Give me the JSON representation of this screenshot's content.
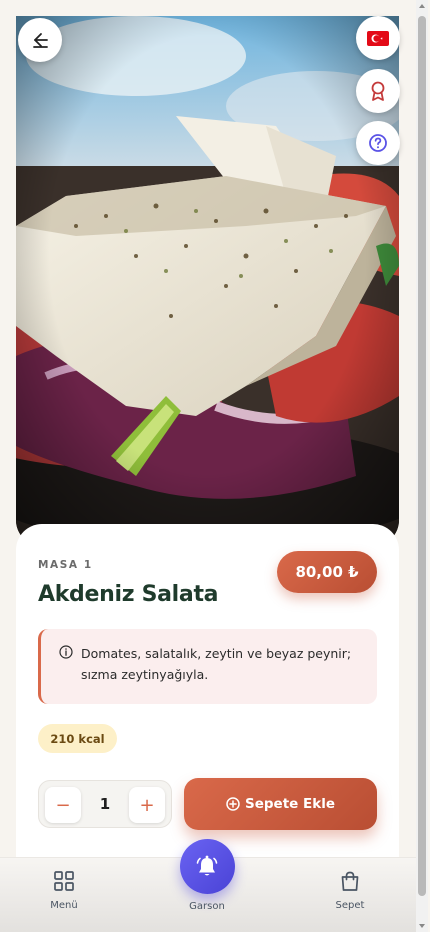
{
  "header": {
    "back_icon": "arrow-left-icon",
    "flag_icon": "turkish-flag-icon",
    "badge_icon": "award-ribbon-icon",
    "help_icon": "question-circle-icon"
  },
  "product": {
    "table_label": "MASA 1",
    "name": "Akdeniz Salata",
    "price": "80,00 ₺",
    "description": "Domates, salatalık, zeytin ve beyaz peynir; sızma zeytinyağıyla.",
    "calories": "210 kcal"
  },
  "cart": {
    "quantity": "1",
    "minus_label": "−",
    "plus_label": "+",
    "add_label": "Sepete Ekle"
  },
  "nav": {
    "menu_label": "Menü",
    "waiter_label": "Garson",
    "cart_label": "Sepet"
  },
  "colors": {
    "accent": "#d9694a",
    "title": "#1f3b2c",
    "waiter": "#5a53e6",
    "kcal_bg": "#fdf0c8",
    "desc_bg": "#fbeeee"
  }
}
